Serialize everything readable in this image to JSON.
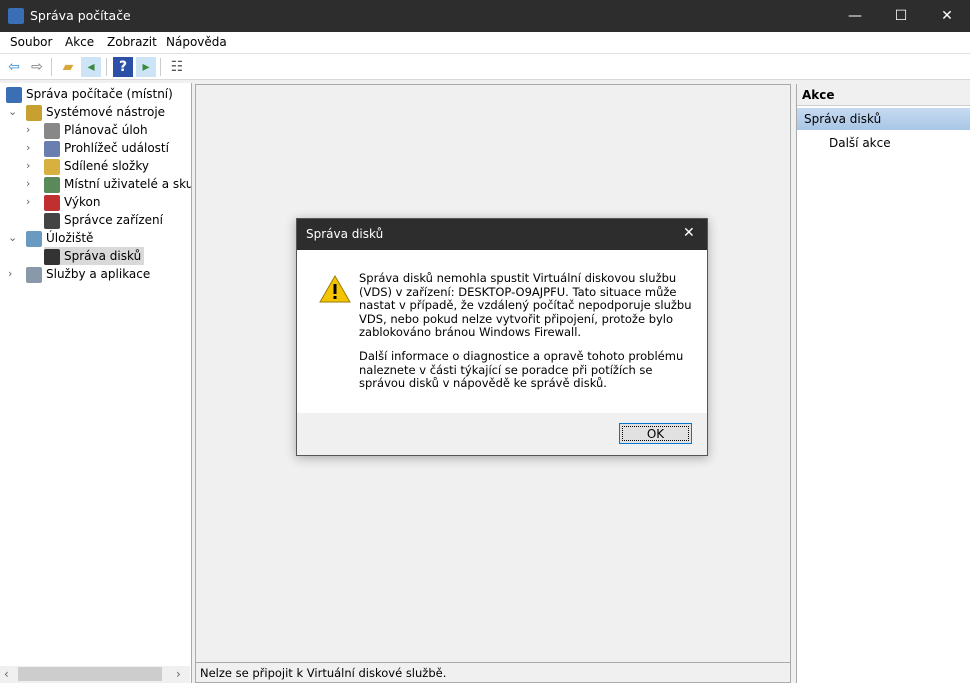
{
  "window": {
    "title": "Správa počítače",
    "minimize": "—",
    "maximize": "☐",
    "close": "✕"
  },
  "menu": [
    "Soubor",
    "Akce",
    "Zobrazit",
    "Nápověda"
  ],
  "tree": [
    {
      "label": "Správa počítače (místní)",
      "chev": "",
      "indent": 0
    },
    {
      "label": "Systémové nástroje",
      "chev": "⌄",
      "indent": 1
    },
    {
      "label": "Plánovač úloh",
      "chev": "›",
      "indent": 2
    },
    {
      "label": "Prohlížeč událostí",
      "chev": "›",
      "indent": 2
    },
    {
      "label": "Sdílené složky",
      "chev": "›",
      "indent": 2
    },
    {
      "label": "Místní uživatelé a skupiny",
      "chev": "›",
      "indent": 2
    },
    {
      "label": "Výkon",
      "chev": "›",
      "indent": 2
    },
    {
      "label": "Správce zařízení",
      "chev": "",
      "indent": 2
    },
    {
      "label": "Úložiště",
      "chev": "⌄",
      "indent": 1
    },
    {
      "label": "Správa disků",
      "chev": "",
      "indent": 2
    },
    {
      "label": "Služby a aplikace",
      "chev": "›",
      "indent": 1
    }
  ],
  "status": "Nelze se připojit k Virtuální diskové službě.",
  "actions": {
    "header": "Akce",
    "section": "Správa disků",
    "item": "Další akce"
  },
  "dialog": {
    "title": "Správa disků",
    "close": "✕",
    "p1": "Správa disků nemohla spustit Virtuální diskovou službu (VDS) v zařízení: DESKTOP-O9AJPFU. Tato situace může nastat v případě, že vzdálený počítač nepodporuje službu VDS, nebo pokud nelze vytvořit připojení, protože bylo zablokováno bránou Windows Firewall.",
    "p2": "Další informace o diagnostice a opravě tohoto problému naleznete v části týkající se poradce při potížích se správou disků v nápovědě ke správě disků.",
    "ok": "OK"
  }
}
